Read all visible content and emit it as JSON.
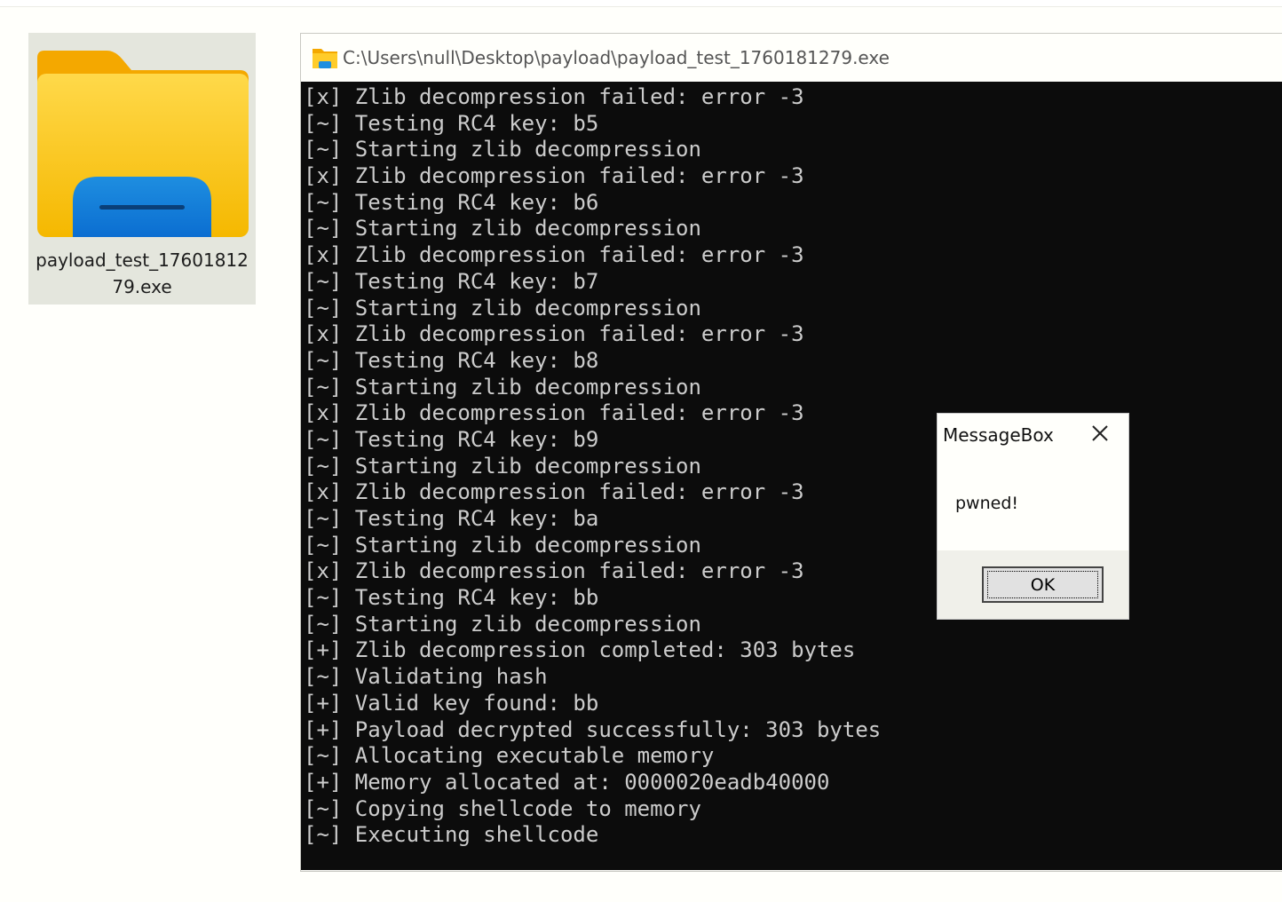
{
  "desktop": {
    "file": {
      "name": "payload_test_1760181279.exe",
      "icon": "folder-icon"
    }
  },
  "console_window": {
    "title": "C:\\Users\\null\\Desktop\\payload\\payload_test_1760181279.exe",
    "icon": "folder-icon",
    "colors": {
      "background": "#0c0c0c",
      "text": "#cccccc"
    },
    "lines": [
      "[x] Zlib decompression failed: error -3",
      "[~] Testing RC4 key: b5",
      "[~] Starting zlib decompression",
      "[x] Zlib decompression failed: error -3",
      "[~] Testing RC4 key: b6",
      "[~] Starting zlib decompression",
      "[x] Zlib decompression failed: error -3",
      "[~] Testing RC4 key: b7",
      "[~] Starting zlib decompression",
      "[x] Zlib decompression failed: error -3",
      "[~] Testing RC4 key: b8",
      "[~] Starting zlib decompression",
      "[x] Zlib decompression failed: error -3",
      "[~] Testing RC4 key: b9",
      "[~] Starting zlib decompression",
      "[x] Zlib decompression failed: error -3",
      "[~] Testing RC4 key: ba",
      "[~] Starting zlib decompression",
      "[x] Zlib decompression failed: error -3",
      "[~] Testing RC4 key: bb",
      "[~] Starting zlib decompression",
      "[+] Zlib decompression completed: 303 bytes",
      "[~] Validating hash",
      "[+] Valid key found: bb",
      "[+] Payload decrypted successfully: 303 bytes",
      "[~] Allocating executable memory",
      "[+] Memory allocated at: 0000020eadb40000",
      "[~] Copying shellcode to memory",
      "[~] Executing shellcode"
    ]
  },
  "message_box": {
    "title": "MessageBox",
    "close_icon": "close-icon",
    "message": "pwned!",
    "ok_label": "OK"
  }
}
